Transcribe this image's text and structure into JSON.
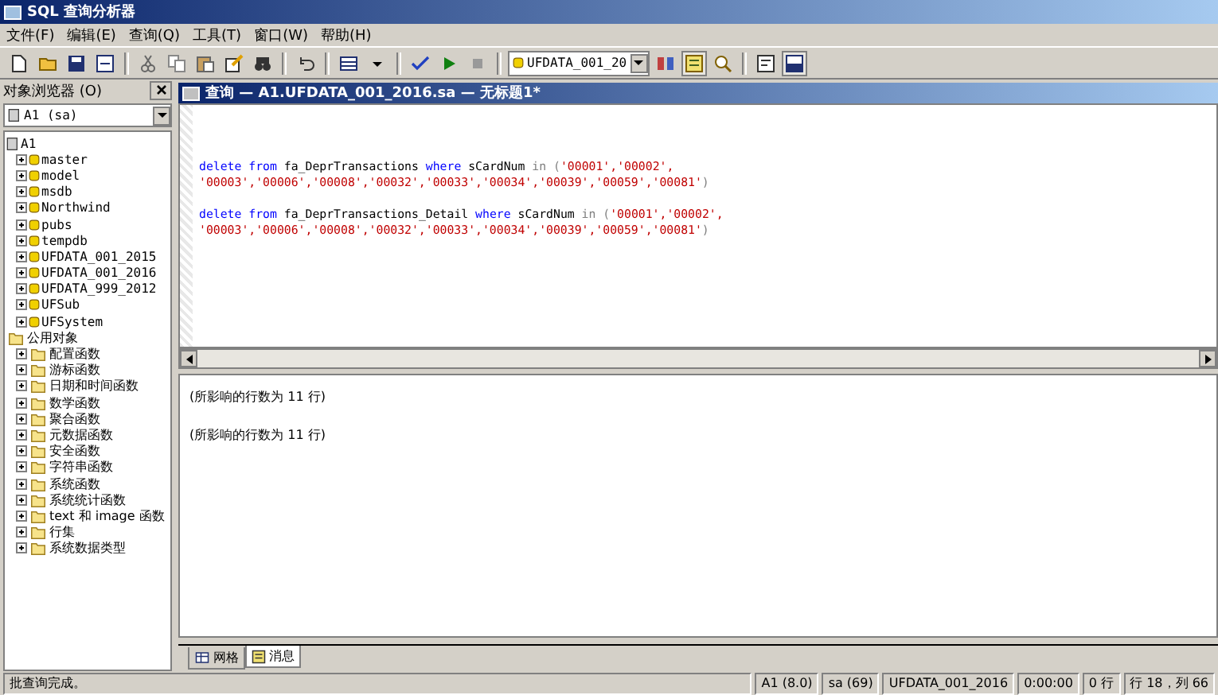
{
  "window": {
    "title": "SQL 查询分析器"
  },
  "menu": [
    "文件(F)",
    "编辑(E)",
    "查询(Q)",
    "工具(T)",
    "窗口(W)",
    "帮助(H)"
  ],
  "toolbar": {
    "database": "UFDATA_001_20"
  },
  "object_browser": {
    "title": "对象浏览器 (O)",
    "server": "A1 (sa)",
    "tree": [
      {
        "label": "A1",
        "kind": "server",
        "children": [
          {
            "label": "master",
            "kind": "database",
            "expanded": false
          },
          {
            "label": "model",
            "kind": "database",
            "expanded": false
          },
          {
            "label": "msdb",
            "kind": "database",
            "expanded": false
          },
          {
            "label": "Northwind",
            "kind": "database",
            "expanded": false
          },
          {
            "label": "pubs",
            "kind": "database",
            "expanded": false
          },
          {
            "label": "tempdb",
            "kind": "database",
            "expanded": false
          },
          {
            "label": "UFDATA_001_2015",
            "kind": "database",
            "expanded": false
          },
          {
            "label": "UFDATA_001_2016",
            "kind": "database",
            "expanded": false
          },
          {
            "label": "UFDATA_999_2012",
            "kind": "database",
            "expanded": false
          },
          {
            "label": "UFSub",
            "kind": "database",
            "expanded": false
          },
          {
            "label": "UFSystem",
            "kind": "database",
            "expanded": false
          }
        ]
      },
      {
        "label": "公用对象",
        "kind": "folder",
        "children": [
          {
            "label": "配置函数",
            "kind": "folder",
            "expanded": false
          },
          {
            "label": "游标函数",
            "kind": "folder",
            "expanded": false
          },
          {
            "label": "日期和时间函数",
            "kind": "folder",
            "expanded": false
          },
          {
            "label": "数学函数",
            "kind": "folder",
            "expanded": false
          },
          {
            "label": "聚合函数",
            "kind": "folder",
            "expanded": false
          },
          {
            "label": "元数据函数",
            "kind": "folder",
            "expanded": false
          },
          {
            "label": "安全函数",
            "kind": "folder",
            "expanded": false
          },
          {
            "label": "字符串函数",
            "kind": "folder",
            "expanded": false
          },
          {
            "label": "系统函数",
            "kind": "folder",
            "expanded": false
          },
          {
            "label": "系统统计函数",
            "kind": "folder",
            "expanded": false
          },
          {
            "label": "text 和 image 函数",
            "kind": "folder",
            "expanded": false
          },
          {
            "label": "行集",
            "kind": "folder",
            "expanded": false
          },
          {
            "label": "系统数据类型",
            "kind": "folder",
            "expanded": false
          }
        ]
      }
    ]
  },
  "query_window": {
    "title": "查询 — A1.UFDATA_001_2016.sa — 无标题1*",
    "code": [
      [
        [
          {
            "kind": "keyword",
            "text": "delete from"
          },
          {
            "kind": "plain",
            "text": " fa_DeprTransactions "
          },
          {
            "kind": "keyword",
            "text": "where"
          },
          {
            "kind": "plain",
            "text": " sCardNum "
          },
          {
            "kind": "operator",
            "text": "in ("
          },
          {
            "kind": "string",
            "text": "'00001','00002',"
          }
        ],
        [
          {
            "kind": "string",
            "text": "'00003','00006','00008','00032','00033','00034','00039','00059','00081'"
          },
          {
            "kind": "operator",
            "text": ")"
          }
        ]
      ],
      [
        [
          {
            "kind": "keyword",
            "text": "delete from"
          },
          {
            "kind": "plain",
            "text": " fa_DeprTransactions_Detail "
          },
          {
            "kind": "keyword",
            "text": "where"
          },
          {
            "kind": "plain",
            "text": " sCardNum "
          },
          {
            "kind": "operator",
            "text": "in ("
          },
          {
            "kind": "string",
            "text": "'00001','00002',"
          }
        ],
        [
          {
            "kind": "string",
            "text": "'00003','00006','00008','00032','00033','00034','00039','00059','00081'"
          },
          {
            "kind": "operator",
            "text": ")"
          }
        ]
      ]
    ],
    "messages": [
      "(所影响的行数为 11 行)",
      "(所影响的行数为 11 行)"
    ],
    "tabs": [
      {
        "label": "网格",
        "selected": false
      },
      {
        "label": "消息",
        "selected": true
      }
    ]
  },
  "status_bar": [
    "批查询完成。",
    "A1 (8.0)",
    "sa (69)",
    "UFDATA_001_2016",
    "0:00:00",
    "0 行",
    "行 18，列 66"
  ]
}
